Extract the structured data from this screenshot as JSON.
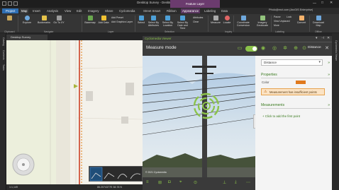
{
  "window": {
    "title": "Desktop Survey - Desktop Survey - ArcGIS Pro",
    "context_tab": "Feature Layer",
    "user": "Pfrolo@esri.com (ArcGIS Enterprise)"
  },
  "tabs": [
    "Project",
    "Map",
    "Insert",
    "Analysis",
    "View",
    "Edit",
    "Imagery",
    "Share",
    "Cyclomedia",
    "Street Smart",
    "Ribbon",
    "Appearance",
    "Labeling",
    "Data"
  ],
  "ribbon": {
    "clipboard": {
      "group": "Clipboard"
    },
    "navigate": {
      "explore": "Explore",
      "bookmarks": "Bookmarks",
      "goto": "Go To XY",
      "group": "Navigate"
    },
    "layer": {
      "basemap": "Basemap",
      "add_data": "Add Data",
      "add_preset": "Add Preset",
      "add_graphics": "Add Graphics Layer",
      "group": "Layer"
    },
    "selection": {
      "select": "Select",
      "by_attributes": "Select By Attributes",
      "by_location": "Select By Location",
      "by_date": "Select By Date and Time",
      "clear": "Clear",
      "group": "Selection"
    },
    "inquiry": {
      "measure": "Measure",
      "locate": "Locate",
      "infographics": "Infographics",
      "attributes": "Attributes",
      "group": "Inquiry"
    },
    "labeling": {
      "convert": "Convert",
      "group": "Labeling"
    },
    "offline": {
      "download_map": "Download Map",
      "group": "Offline"
    },
    "coordinate": {
      "label": "Coordinate Conversion"
    },
    "locate_btn": "Locate",
    "imagery": {
      "geolocate": "Imagery Geolocate"
    },
    "pause": "Pause",
    "lock": "Lock",
    "view_unplaced": "View Unplaced",
    "more": "More",
    "connect": "Connect"
  },
  "left_strip": [
    "Catalog",
    "Contents",
    "Tasks"
  ],
  "right_strip": [
    "Cyclomedia Viewer"
  ],
  "map": {
    "tab": "Desktop Survey"
  },
  "status": {
    "scale": "1:1,149",
    "coords": "86.2074377E 38.78 N"
  },
  "cyclomedia": {
    "pane_title": "Cyclomedia Viewer",
    "title": "Measure mode",
    "distance_label": "Distance",
    "select_value": "Distance",
    "properties": "Properties",
    "color_label": "Color",
    "color": "#e0791e",
    "warning": "Measurement has insufficient points",
    "measurements": "Measurements",
    "add_point": "Click to add the first point",
    "watermark": "© 2021 Cyclomedia"
  },
  "colors": {
    "accent": "#8bc34a",
    "project": "#2f6fb3",
    "context": "#6b3b6e"
  }
}
